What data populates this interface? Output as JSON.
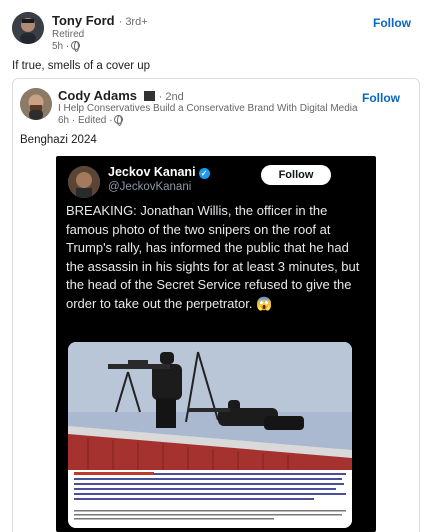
{
  "post": {
    "author": "Tony Ford",
    "degree": "· 3rd+",
    "headline": "Retired",
    "time": "5h ·",
    "follow_label": "Follow",
    "text": "If true, smells of a cover up"
  },
  "repost": {
    "author": "Cody Adams",
    "degree": "· 2nd",
    "headline": "I Help Conservatives Build a Conservative Brand With Digital Media | Hire...",
    "time": "6h · Edited ·",
    "follow_label": "Follow",
    "text": "Benghazi 2024"
  },
  "tweet": {
    "name": "Jeckov Kanani",
    "handle": "@JeckovKanani",
    "follow_label": "Follow",
    "text": "BREAKING: Jonathan Willis, the officer in the famous photo of the two snipers on the roof at Trump's rally, has informed the public that he had the assassin in his sights for at least 3 minutes, but the head of the Secret Service refused to give the order to take out the perpetrator. 😱"
  }
}
